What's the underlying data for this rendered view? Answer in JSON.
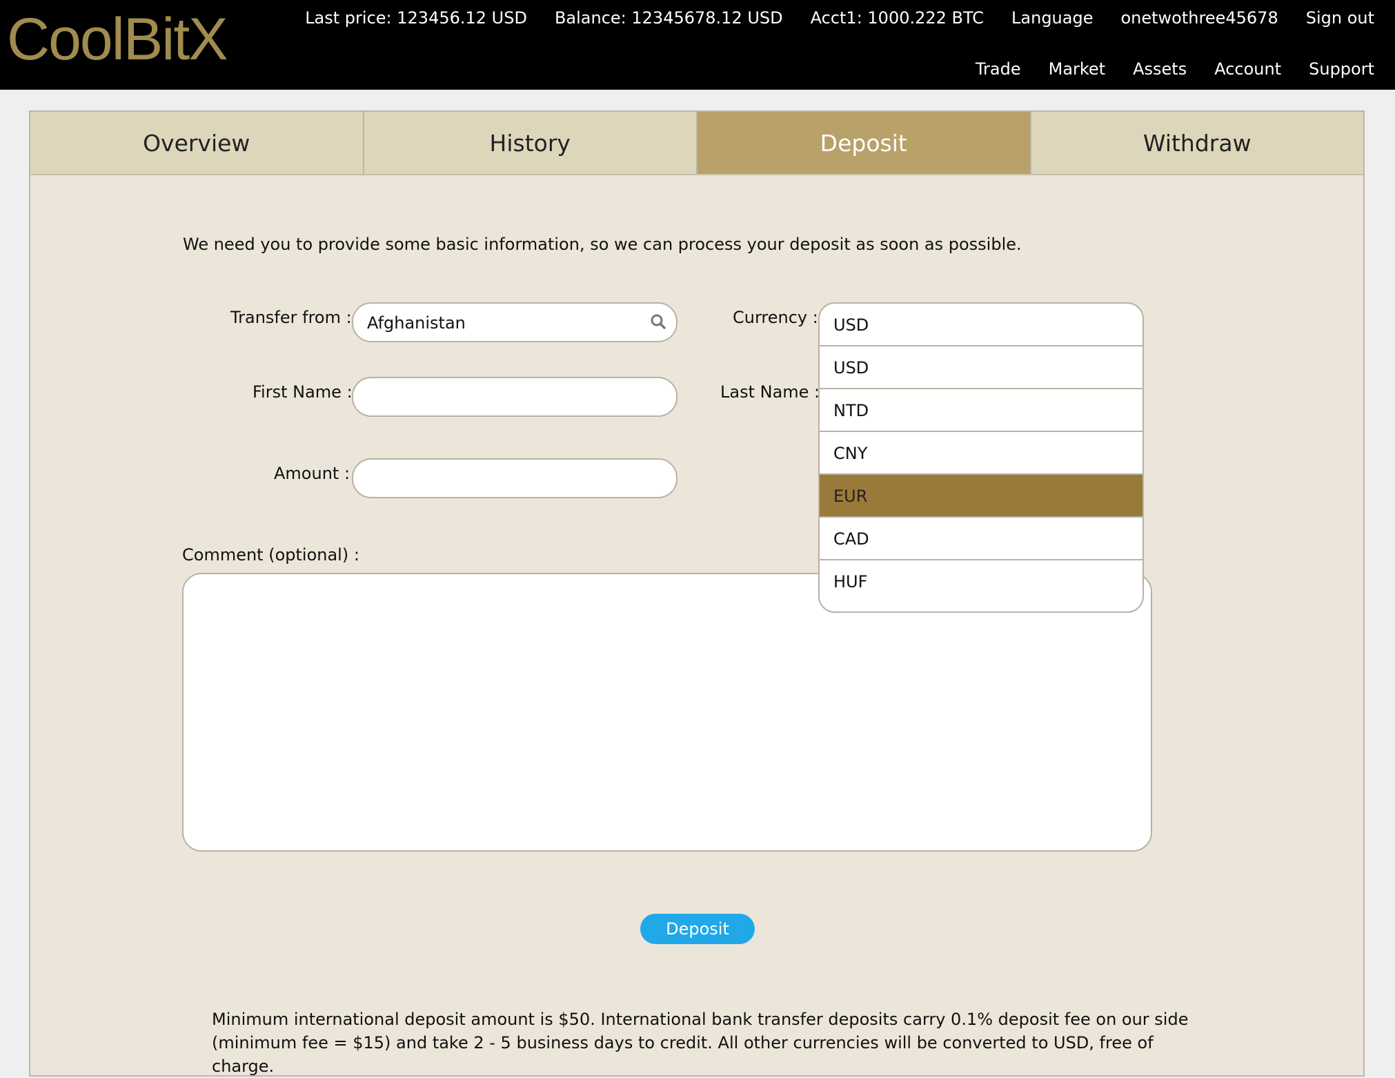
{
  "brand": {
    "logo_text": "CoolBitX",
    "accent": "#a08c4e"
  },
  "header": {
    "info": {
      "last_price": "Last price: 123456.12 USD",
      "balance": "Balance: 12345678.12 USD",
      "acct": "Acct1: 1000.222 BTC",
      "language": "Language",
      "username": "onetwothree45678",
      "signout": "Sign out"
    },
    "nav": {
      "trade": "Trade",
      "market": "Market",
      "assets": "Assets",
      "account": "Account",
      "support": "Support"
    }
  },
  "tabs": [
    {
      "label": "Overview"
    },
    {
      "label": "History"
    },
    {
      "label": "Deposit",
      "active": true
    },
    {
      "label": "Withdraw"
    }
  ],
  "form": {
    "intro": "We need you to provide some basic information, so we can process your deposit as soon as possible.",
    "transfer_from_label": "Transfer from :",
    "transfer_from_value": "Afghanistan",
    "currency_label": "Currency :",
    "first_name_label": "First Name :",
    "first_name_value": "",
    "last_name_label": "Last Name :",
    "amount_label": "Amount :",
    "amount_value": "",
    "comment_label": "Comment (optional) :",
    "deposit_button": "Deposit",
    "button_color": "#20a8e8",
    "footnote": "Minimum international deposit amount is $50. International bank transfer deposits carry 0.1% deposit fee on our side (minimum fee = $15) and take 2 - 5 business days to credit. All other currencies will be converted to USD, free of charge."
  },
  "currency_dropdown": {
    "current": "USD",
    "options": [
      "USD",
      "NTD",
      "CNY",
      "EUR",
      "CAD",
      "HUF"
    ],
    "highlighted": "EUR",
    "highlight_color": "#9a7a38"
  }
}
